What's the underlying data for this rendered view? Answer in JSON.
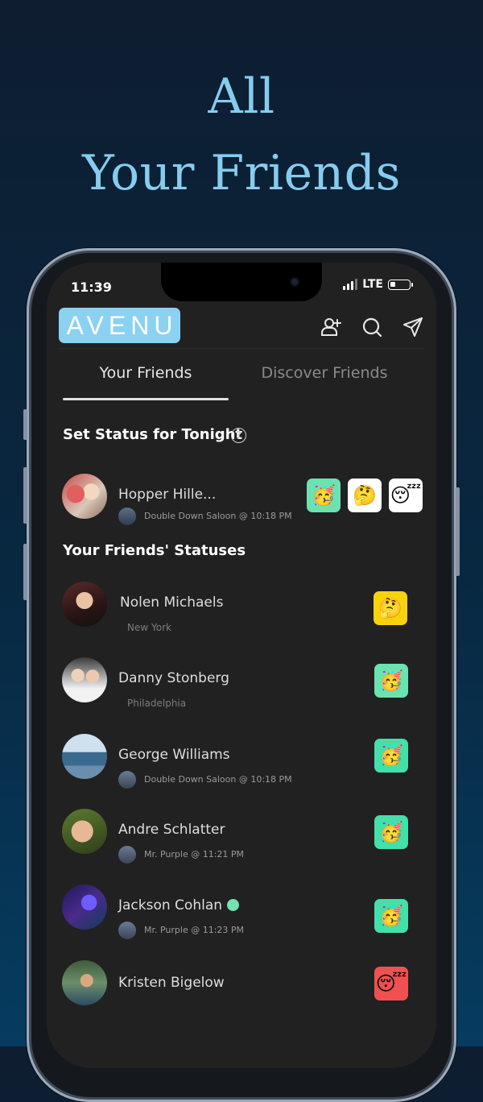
{
  "headline": {
    "line1": "All",
    "line2": "Your Friends",
    "color": "#86ccef"
  },
  "status_bar": {
    "time": "11:39",
    "network": "LTE"
  },
  "app": {
    "logo": "AVENU",
    "logo_color": "#8bd1f1"
  },
  "header_icons": [
    "add-user-icon",
    "search-icon",
    "send-icon"
  ],
  "tabs": [
    {
      "label": "Your Friends",
      "active": true
    },
    {
      "label": "Discover Friends",
      "active": false
    }
  ],
  "set_status": {
    "title": "Set Status for Tonight",
    "help_symbol": "?",
    "user": {
      "name": "Hopper Hille...",
      "venue": "Double Down Saloon @ 10:18 PM"
    },
    "options": [
      {
        "emoji": "🥳",
        "bg": "#6be3b0"
      },
      {
        "emoji": "🤔",
        "bg": "#ffffff"
      },
      {
        "emoji": "😴",
        "bg": "#ffffff"
      }
    ]
  },
  "friends_section": {
    "title": "Your Friends' Statuses"
  },
  "friends": [
    {
      "name": "Nolen Michaels",
      "sub": "New York",
      "emoji": "🤔",
      "bg": "#f7d30c"
    },
    {
      "name": "Danny Stonberg",
      "sub": "Philadelphia",
      "emoji": "🥳",
      "bg": "#6be3b0"
    },
    {
      "name": "George Williams",
      "sub": "Double Down Saloon @ 10:18 PM",
      "emoji": "🥳",
      "bg": "#43e0aa"
    },
    {
      "name": "Andre Schlatter",
      "sub": "Mr. Purple @ 11:21 PM",
      "emoji": "🥳",
      "bg": "#43e0aa"
    },
    {
      "name": "Jackson Cohlan",
      "sub": "Mr. Purple @ 11:23 PM",
      "emoji": "🥳",
      "bg": "#43e0aa",
      "online": true
    },
    {
      "name": "Kristen  Bigelow",
      "sub": "",
      "emoji": "😴",
      "bg": "#f05050"
    }
  ]
}
